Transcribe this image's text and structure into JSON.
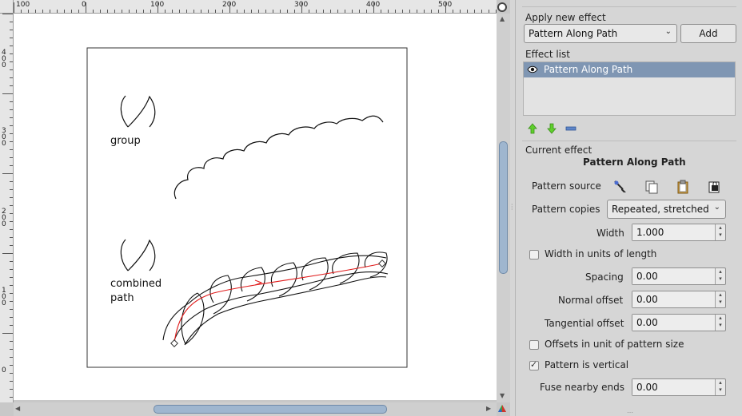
{
  "canvas": {
    "hruler_labels": [
      "100",
      "0",
      "100",
      "200",
      "300",
      "400",
      "500"
    ],
    "vruler_labels": [
      "4 0 0",
      "3 0 0",
      "2 0 0",
      "1 0 0",
      "0"
    ],
    "group_label": "group",
    "combined_label_line1": "combined",
    "combined_label_line2": "path",
    "path_color": "#e01b1b"
  },
  "panel": {
    "apply_new_effect_label": "Apply new effect",
    "effect_select_value": "Pattern Along Path",
    "add_button_label": "Add",
    "effect_list_label": "Effect list",
    "effect_list_items": [
      {
        "label": "Pattern Along Path",
        "visible": true
      }
    ],
    "current_effect_label": "Current effect",
    "current_effect_title": "Pattern Along Path",
    "pattern_source_label": "Pattern source",
    "pattern_copies_label": "Pattern copies",
    "pattern_copies_value": "Repeated, stretched",
    "width_label": "Width",
    "width_value": "1.000",
    "width_in_units_label": "Width in units of length",
    "width_in_units_checked": false,
    "spacing_label": "Spacing",
    "spacing_value": "0.00",
    "normal_offset_label": "Normal offset",
    "normal_offset_value": "0.00",
    "tangential_offset_label": "Tangential offset",
    "tangential_offset_value": "0.00",
    "offsets_in_unit_label": "Offsets in unit of pattern size",
    "offsets_in_unit_checked": false,
    "pattern_vertical_label": "Pattern is vertical",
    "pattern_vertical_checked": true,
    "fuse_nearby_ends_label": "Fuse nearby ends",
    "fuse_nearby_ends_value": "0.00"
  }
}
